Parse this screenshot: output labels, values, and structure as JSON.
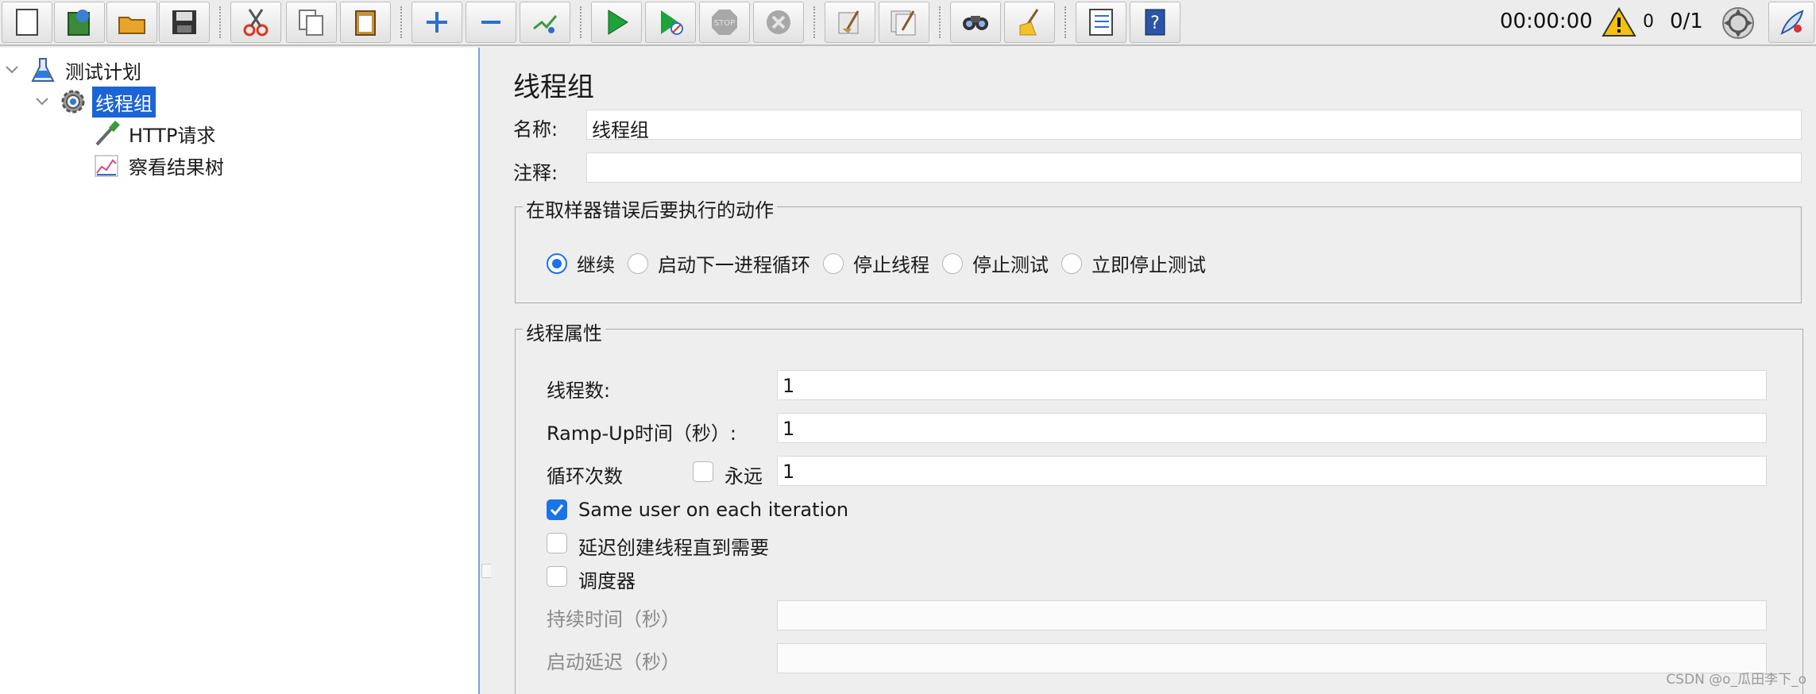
{
  "toolbar": {
    "timer": "00:00:00",
    "warning_count": "0",
    "thread_ratio": "0/1",
    "buttons": [
      {
        "name": "new-icon"
      },
      {
        "name": "templates-icon"
      },
      {
        "name": "open-icon"
      },
      {
        "name": "save-icon"
      },
      {
        "name": "cut-icon"
      },
      {
        "name": "copy-icon"
      },
      {
        "name": "paste-icon"
      },
      {
        "name": "expand-icon"
      },
      {
        "name": "collapse-icon"
      },
      {
        "name": "toggle-icon"
      },
      {
        "name": "start-icon"
      },
      {
        "name": "start-no-pause-icon"
      },
      {
        "name": "stop-icon"
      },
      {
        "name": "shutdown-icon"
      },
      {
        "name": "clear-icon"
      },
      {
        "name": "clear-all-icon"
      },
      {
        "name": "search-icon"
      },
      {
        "name": "reset-search-icon"
      },
      {
        "name": "function-helper-icon"
      },
      {
        "name": "help-icon"
      }
    ]
  },
  "tree": {
    "items": [
      {
        "label": "测试计划",
        "icon": "flask-icon"
      },
      {
        "label": "线程组",
        "icon": "gear-icon",
        "selected": true
      },
      {
        "label": "HTTP请求",
        "icon": "pipette-icon"
      },
      {
        "label": "察看结果树",
        "icon": "chart-icon"
      }
    ]
  },
  "form": {
    "title": "线程组",
    "name_label": "名称:",
    "name_value": "线程组",
    "comment_label": "注释:",
    "comment_value": "",
    "error_group_title": "在取样器错误后要执行的动作",
    "error_actions": [
      "继续",
      "启动下一进程循环",
      "停止线程",
      "停止测试",
      "立即停止测试"
    ],
    "error_selected": 0,
    "thread_group_title": "线程属性",
    "threads_label": "线程数:",
    "threads_value": "1",
    "rampup_label": "Ramp-Up时间（秒）:",
    "rampup_value": "1",
    "loop_label": "循环次数",
    "forever_label": "永远",
    "loop_value": "1",
    "same_user_label": "Same user on each iteration",
    "same_user_checked": true,
    "delay_label": "延迟创建线程直到需要",
    "delay_checked": false,
    "scheduler_label": "调度器",
    "scheduler_checked": false,
    "duration_label": "持续时间（秒）",
    "duration_value": "",
    "startup_delay_label": "启动延迟（秒）",
    "startup_delay_value": ""
  },
  "watermark": "CSDN @o_瓜田李下_o"
}
